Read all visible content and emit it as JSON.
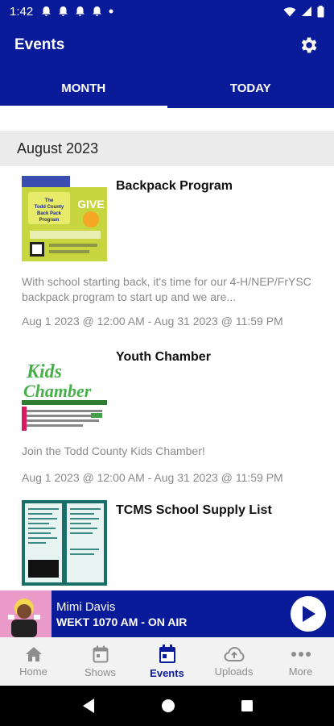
{
  "status_bar": {
    "time": "1:42"
  },
  "app_bar": {
    "title": "Events"
  },
  "tabs": [
    {
      "label": "MONTH",
      "active": true
    },
    {
      "label": "TODAY",
      "active": false
    }
  ],
  "month_header": "August 2023",
  "events": [
    {
      "title": "Backpack Program",
      "description": "With school starting back, it's time for our 4-H/NEP/FrYSC backpack program to start up and we are...",
      "date": "Aug 1 2023 @ 12:00 AM - Aug 31 2023 @ 11:59 PM"
    },
    {
      "title": "Youth Chamber",
      "description": "Join the Todd County Kids Chamber!",
      "date": "Aug 1 2023 @ 12:00 AM - Aug 31 2023 @ 11:59 PM"
    },
    {
      "title": "TCMS School Supply List"
    }
  ],
  "player": {
    "host": "Mimi Davis",
    "station": "WEKT 1070 AM - ON AIR"
  },
  "bottom_nav": [
    {
      "label": "Home",
      "icon": "home-icon"
    },
    {
      "label": "Shows",
      "icon": "calendar-outline-icon"
    },
    {
      "label": "Events",
      "icon": "calendar-icon",
      "active": true
    },
    {
      "label": "Uploads",
      "icon": "cloud-upload-icon"
    },
    {
      "label": "More",
      "icon": "more-dots-icon"
    }
  ],
  "colors": {
    "primary": "#0a1b9a",
    "muted_text": "#8a8a8a",
    "nav_inactive": "#8d8d8d"
  }
}
